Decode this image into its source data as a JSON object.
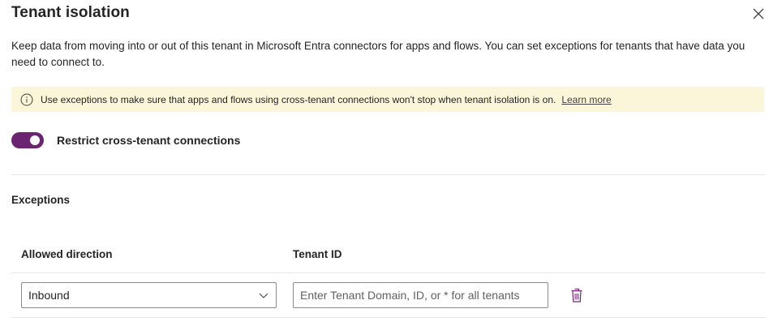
{
  "panel": {
    "title": "Tenant isolation",
    "close_icon": "close-icon",
    "description": "Keep data from moving into or out of this tenant in Microsoft Entra connectors for apps and flows. You can set exceptions for tenants that have data you need to connect to."
  },
  "banner": {
    "icon": "info-icon",
    "message": "Use exceptions to make sure that apps and flows using cross-tenant connections won't stop when tenant isolation is on.",
    "link_label": "Learn more",
    "background": "#fbf6d9"
  },
  "toggle": {
    "label": "Restrict cross-tenant connections",
    "on": true,
    "accent": "#6b2470"
  },
  "exceptions": {
    "section_label": "Exceptions",
    "columns": {
      "direction": "Allowed direction",
      "tenant_id": "Tenant ID"
    },
    "rows": [
      {
        "direction": "Inbound",
        "tenant_id_value": "",
        "tenant_id_placeholder": "Enter Tenant Domain, ID, or * for all tenants",
        "delete_icon": "trash-icon"
      }
    ]
  }
}
